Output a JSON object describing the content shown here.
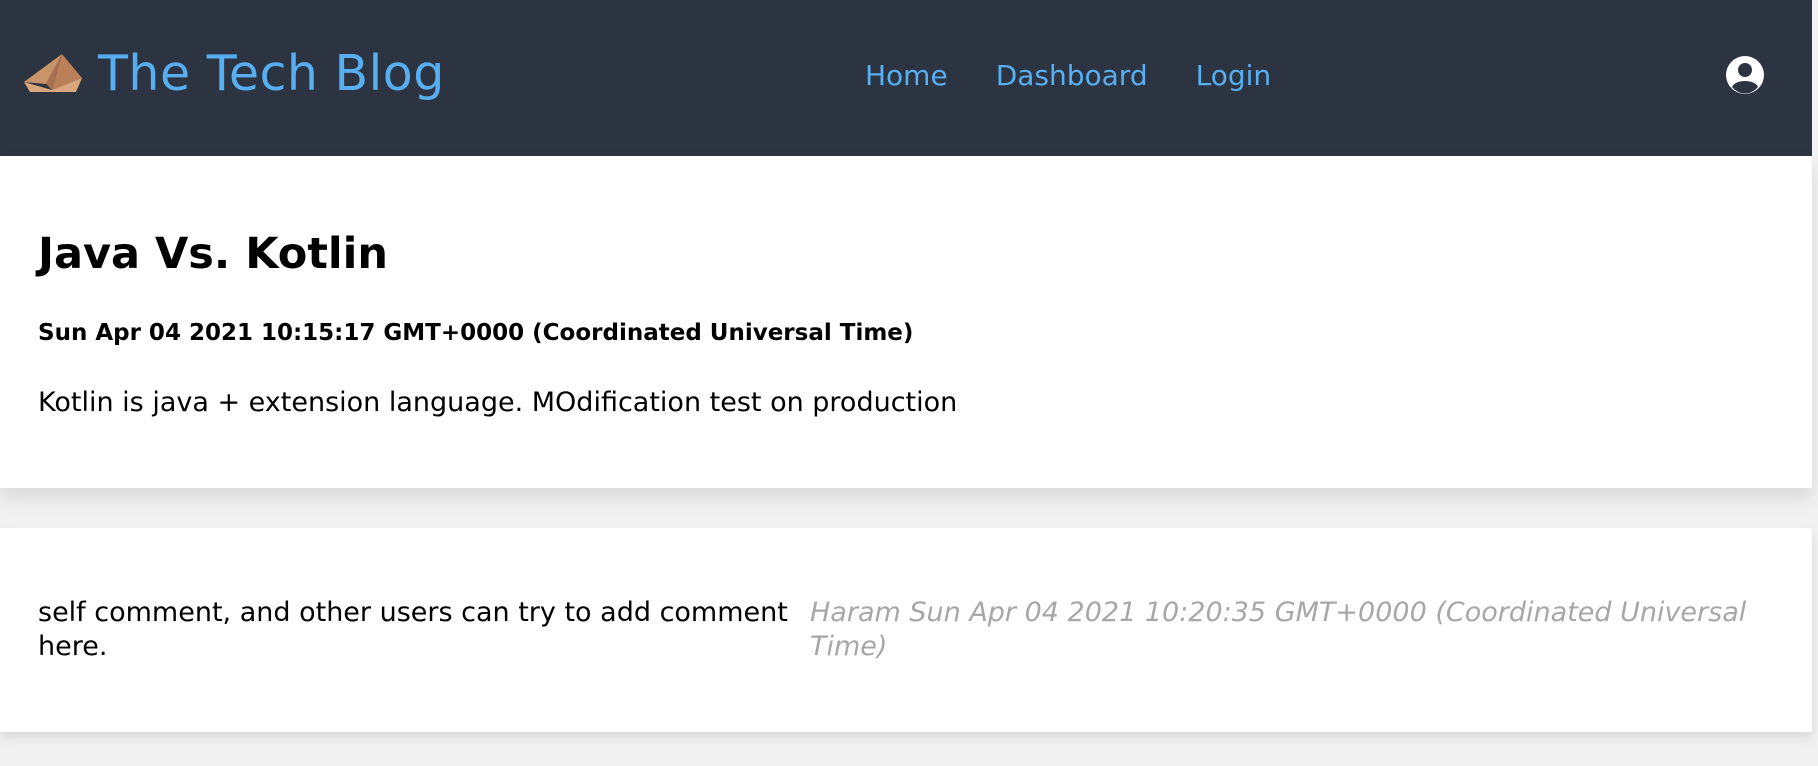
{
  "header": {
    "brand_title": "The Tech Blog",
    "logo_icon": "paper-plane-icon",
    "nav_items": [
      "Home",
      "Dashboard",
      "Login"
    ],
    "user_icon": "user-circle-icon",
    "background_color": "#2c3442",
    "link_color": "#57aff1"
  },
  "post": {
    "title": "Java Vs. Kotlin",
    "date": "Sun Apr 04 2021 10:15:17 GMT+0000 (Coordinated Universal Time)",
    "body": "Kotlin is java + extension language. MOdification test on production"
  },
  "comments": [
    {
      "text": "self comment, and other users can try to add comment here.",
      "meta": "Haram Sun Apr 04 2021 10:20:35 GMT+0000 (Coordinated Universal Time)"
    }
  ]
}
